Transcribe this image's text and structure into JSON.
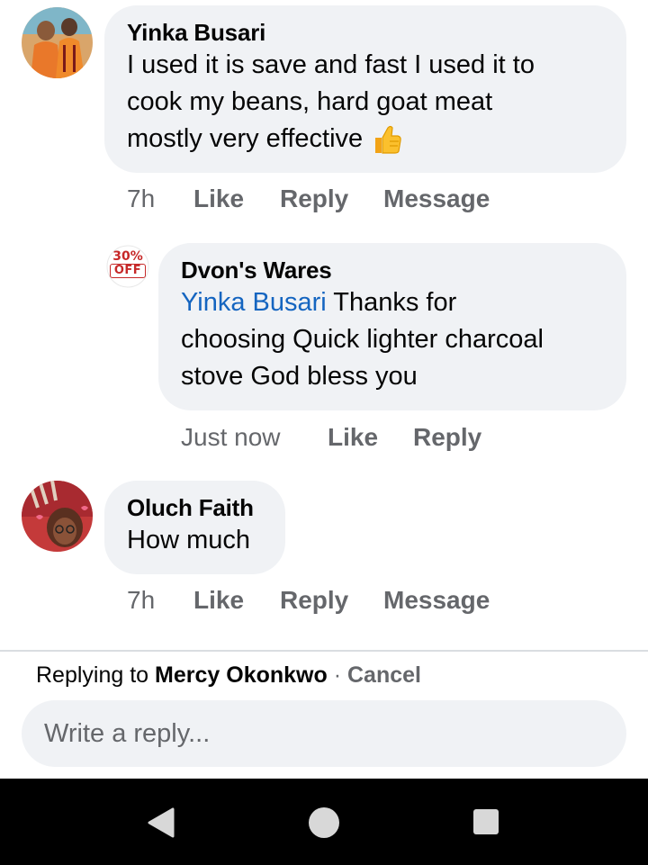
{
  "comments": [
    {
      "author": "Yinka Busari",
      "lines": [
        "I used it is save and fast I used it to",
        "cook my beans, hard goat meat",
        "mostly very effective"
      ],
      "emoji": "thumbs-up",
      "time": "7h",
      "like": "Like",
      "reply": "Reply",
      "message": "Message"
    },
    {
      "author": "Dvon's Wares",
      "badge": [
        "30%",
        "OFF"
      ],
      "mention": "Yinka Busari",
      "first_line_rest": " Thanks for",
      "lines": [
        "choosing Quick lighter charcoal",
        "stove God bless you"
      ],
      "time": "Just now",
      "like": "Like",
      "reply": "Reply"
    },
    {
      "author": "Oluch Faith",
      "lines": [
        "How much"
      ],
      "time": "7h",
      "like": "Like",
      "reply": "Reply",
      "message": "Message"
    }
  ],
  "composer": {
    "replying_prefix": "Replying to ",
    "replying_name": "Mercy Okonkwo",
    "separator": " · ",
    "cancel": "Cancel",
    "placeholder": "Write a reply..."
  },
  "navbar": {
    "back_icon": "triangle-back",
    "home_icon": "circle-home",
    "recents_icon": "square-recents"
  },
  "colors": {
    "bubble": "#f0f2f5",
    "mention": "#1565c0",
    "meta": "#65676b"
  }
}
